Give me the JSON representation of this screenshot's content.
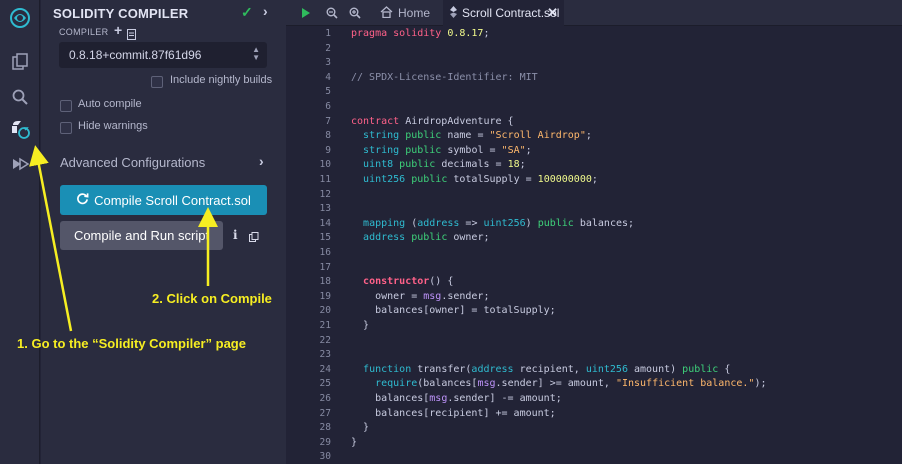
{
  "panel": {
    "title": "SOLIDITY COMPILER",
    "compiler_label": "COMPILER",
    "compiler_version": "0.8.18+commit.87f61d96",
    "include_nightly_label": "Include nightly builds",
    "auto_compile_label": "Auto compile",
    "hide_warnings_label": "Hide warnings",
    "advanced_label": "Advanced Configurations",
    "compile_button": "Compile Scroll Contract.sol",
    "compile_run_button": "Compile and Run script"
  },
  "tabs": {
    "home_label": "Home",
    "active_label": "Scroll Contract.sol"
  },
  "annotations": {
    "step1": "1. Go to the “Solidity Compiler” page",
    "step2": "2. Click on Compile"
  },
  "colors": {
    "accent_button": "#1a8fb5",
    "annotation": "#f6ee22",
    "status_ok": "#2fbb5d"
  },
  "icons": [
    "remix-logo-icon",
    "file-explorer-icon",
    "search-icon",
    "solidity-compiler-icon",
    "deploy-run-icon",
    "run-icon",
    "zoom-out-icon",
    "zoom-in-icon",
    "home-icon",
    "file-icon",
    "close-icon",
    "check-icon",
    "chevron-right-icon",
    "plus-icon",
    "document-icon",
    "refresh-icon",
    "info-icon",
    "copy-icon"
  ],
  "editor": {
    "lines": [
      {
        "n": "1",
        "tokens": [
          {
            "t": "pragma solidity ",
            "c": "kw"
          },
          {
            "t": "0.8.17",
            "c": "num"
          },
          {
            "t": ";",
            "c": "id"
          }
        ]
      },
      {
        "n": "2",
        "tokens": []
      },
      {
        "n": "3",
        "tokens": []
      },
      {
        "n": "4",
        "tokens": [
          {
            "t": "// SPDX-License-Identifier: MIT",
            "c": "com"
          }
        ]
      },
      {
        "n": "5",
        "tokens": []
      },
      {
        "n": "6",
        "tokens": []
      },
      {
        "n": "7",
        "tokens": [
          {
            "t": "contract ",
            "c": "kw"
          },
          {
            "t": "AirdropAdventure {",
            "c": "id"
          }
        ]
      },
      {
        "n": "8",
        "tokens": [
          {
            "t": "  ",
            "c": "id"
          },
          {
            "t": "string ",
            "c": "ty"
          },
          {
            "t": "public ",
            "c": "pub"
          },
          {
            "t": "name = ",
            "c": "id"
          },
          {
            "t": "\"Scroll Airdrop\"",
            "c": "str"
          },
          {
            "t": ";",
            "c": "id"
          }
        ]
      },
      {
        "n": "9",
        "tokens": [
          {
            "t": "  ",
            "c": "id"
          },
          {
            "t": "string ",
            "c": "ty"
          },
          {
            "t": "public ",
            "c": "pub"
          },
          {
            "t": "symbol = ",
            "c": "id"
          },
          {
            "t": "\"SA\"",
            "c": "str"
          },
          {
            "t": ";",
            "c": "id"
          }
        ]
      },
      {
        "n": "10",
        "tokens": [
          {
            "t": "  ",
            "c": "id"
          },
          {
            "t": "uint8 ",
            "c": "ty"
          },
          {
            "t": "public ",
            "c": "pub"
          },
          {
            "t": "decimals = ",
            "c": "id"
          },
          {
            "t": "18",
            "c": "num"
          },
          {
            "t": ";",
            "c": "id"
          }
        ]
      },
      {
        "n": "11",
        "tokens": [
          {
            "t": "  ",
            "c": "id"
          },
          {
            "t": "uint256 ",
            "c": "ty"
          },
          {
            "t": "public ",
            "c": "pub"
          },
          {
            "t": "totalSupply = ",
            "c": "id"
          },
          {
            "t": "100000000",
            "c": "num"
          },
          {
            "t": ";",
            "c": "id"
          }
        ]
      },
      {
        "n": "12",
        "tokens": []
      },
      {
        "n": "13",
        "tokens": []
      },
      {
        "n": "14",
        "tokens": [
          {
            "t": "  ",
            "c": "id"
          },
          {
            "t": "mapping ",
            "c": "ty"
          },
          {
            "t": "(",
            "c": "id"
          },
          {
            "t": "address ",
            "c": "ty"
          },
          {
            "t": "=> ",
            "c": "id"
          },
          {
            "t": "uint256",
            "c": "ty"
          },
          {
            "t": ") ",
            "c": "id"
          },
          {
            "t": "public ",
            "c": "pub"
          },
          {
            "t": "balances;",
            "c": "id"
          }
        ]
      },
      {
        "n": "15",
        "tokens": [
          {
            "t": "  ",
            "c": "id"
          },
          {
            "t": "address ",
            "c": "ty"
          },
          {
            "t": "public ",
            "c": "pub"
          },
          {
            "t": "owner;",
            "c": "id"
          }
        ]
      },
      {
        "n": "16",
        "tokens": []
      },
      {
        "n": "17",
        "tokens": []
      },
      {
        "n": "18",
        "tokens": [
          {
            "t": "  ",
            "c": "id"
          },
          {
            "t": "constructor",
            "c": "ctor"
          },
          {
            "t": "() {",
            "c": "id"
          }
        ]
      },
      {
        "n": "19",
        "tokens": [
          {
            "t": "    owner = ",
            "c": "id"
          },
          {
            "t": "msg",
            "c": "msg"
          },
          {
            "t": ".sender;",
            "c": "id"
          }
        ]
      },
      {
        "n": "20",
        "tokens": [
          {
            "t": "    balances[owner] = totalSupply;",
            "c": "id"
          }
        ]
      },
      {
        "n": "21",
        "tokens": [
          {
            "t": "  }",
            "c": "id"
          }
        ]
      },
      {
        "n": "22",
        "tokens": []
      },
      {
        "n": "23",
        "tokens": []
      },
      {
        "n": "24",
        "tokens": [
          {
            "t": "  ",
            "c": "id"
          },
          {
            "t": "function ",
            "c": "ty"
          },
          {
            "t": "transfer(",
            "c": "id"
          },
          {
            "t": "address ",
            "c": "ty"
          },
          {
            "t": "recipient, ",
            "c": "id"
          },
          {
            "t": "uint256 ",
            "c": "ty"
          },
          {
            "t": "amount) ",
            "c": "id"
          },
          {
            "t": "public ",
            "c": "pub"
          },
          {
            "t": "{",
            "c": "id"
          }
        ]
      },
      {
        "n": "25",
        "tokens": [
          {
            "t": "    ",
            "c": "id"
          },
          {
            "t": "require",
            "c": "ty"
          },
          {
            "t": "(balances[",
            "c": "id"
          },
          {
            "t": "msg",
            "c": "msg"
          },
          {
            "t": ".sender] >= amount, ",
            "c": "id"
          },
          {
            "t": "\"Insufficient balance.\"",
            "c": "str"
          },
          {
            "t": ");",
            "c": "id"
          }
        ]
      },
      {
        "n": "26",
        "tokens": [
          {
            "t": "    balances[",
            "c": "id"
          },
          {
            "t": "msg",
            "c": "msg"
          },
          {
            "t": ".sender] -= amount;",
            "c": "id"
          }
        ]
      },
      {
        "n": "27",
        "tokens": [
          {
            "t": "    balances[recipient] += amount;",
            "c": "id"
          }
        ]
      },
      {
        "n": "28",
        "tokens": [
          {
            "t": "  }",
            "c": "id"
          }
        ]
      },
      {
        "n": "29",
        "tokens": [
          {
            "t": "}",
            "c": "id"
          }
        ]
      },
      {
        "n": "30",
        "tokens": []
      }
    ]
  }
}
